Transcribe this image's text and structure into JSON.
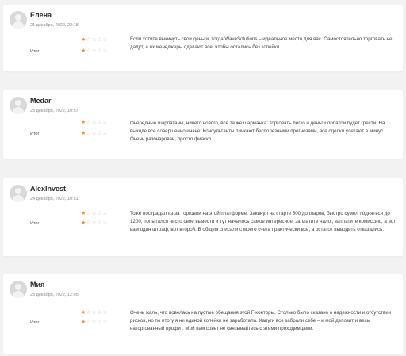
{
  "reviews": [
    {
      "name": "Елена",
      "date": "21 декабря, 2022, 22:18",
      "itog_label": "Итог:",
      "rating_top": 1,
      "rating_bottom": 1,
      "max_stars": 5,
      "text": "Если хотите выкинуть свои деньги, тогда WaveSolutions – идеальное место для вас. Самостоятельно торговать не дадут, а их менеджеры сделают все, чтобы остались без копейки."
    },
    {
      "name": "Medar",
      "date": "23 декабря, 2022, 10:57",
      "itog_label": "Итог:",
      "rating_top": 1,
      "rating_bottom": 1,
      "max_stars": 5,
      "text": "Очередные шарлатаны, ничего нового, все та же шарманка: торговать легко и деньги лопатой будет грести. На выходе все совершенно иначе. Консультанты пичкают бесполезными прогнозами, все сделки улетают в минус. Очень разочарован, просто фиаско."
    },
    {
      "name": "AlexInvest",
      "date": "24 декабря, 2022, 10:51",
      "itog_label": "Итог:",
      "rating_top": 1,
      "rating_bottom": 1,
      "max_stars": 5,
      "text": "Тоже пострадал из-за торговли на этой платформе. Закинул на старте 500 долларов, быстро сумел подняться до 1200, попытался чисто свое вывести и тут началось самое интересное: заплатите налог, заплатите комиссию, а вот вам один штраф, вот второй. В общем списали с моего счета практически все, а остаток выводить отказались."
    },
    {
      "name": "Мия",
      "date": "23 декабря, 2022, 12:05",
      "itog_label": "Итог:",
      "rating_top": 1,
      "rating_bottom": 1,
      "max_stars": 5,
      "text": "Очень жаль, что повелась на пустые обещания этой Г-конторы. Столько было сказано о надежности и отсутствии рисков, но по итогу я ни единой копейки не заработала. Хапуги все забрали себе – и мой депозит и весь наторгованный профит. Мой вам совет не связывайтесь с этими проходимцами."
    }
  ],
  "colors": {
    "star_active": "#e8933a",
    "star_inactive": "#c8c8c8",
    "background": "#f2f2f2",
    "card": "#ffffff"
  }
}
